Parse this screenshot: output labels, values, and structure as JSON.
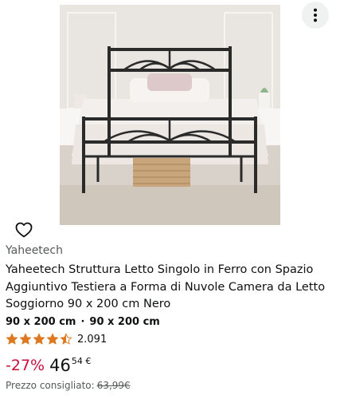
{
  "product": {
    "brand": "Yaheetech",
    "title": "Yaheetech Struttura Letto Singolo in Ferro con Spazio Aggiuntivo Testiera a Forma di Nuvole Camera da Letto Soggiorno 90 x 200 cm Nero",
    "variants": [
      "90 x 200 cm",
      "90 x 200 cm"
    ],
    "variant_separator": "·",
    "rating": {
      "value": 4.5,
      "count": "2.091"
    },
    "price": {
      "discount": "-27%",
      "integer": "46",
      "decimal": "54 €"
    },
    "list_price": {
      "label": "Prezzo consigliato:",
      "value": "63,99€"
    }
  },
  "icons": {
    "more": "more-vertical-icon",
    "favorite": "heart-outline-icon",
    "star": "star-icon"
  },
  "colors": {
    "star": "#de7921",
    "discount": "#cc0c39",
    "secondary_text": "#565959",
    "more_button_bg": "#f0f2f2"
  }
}
